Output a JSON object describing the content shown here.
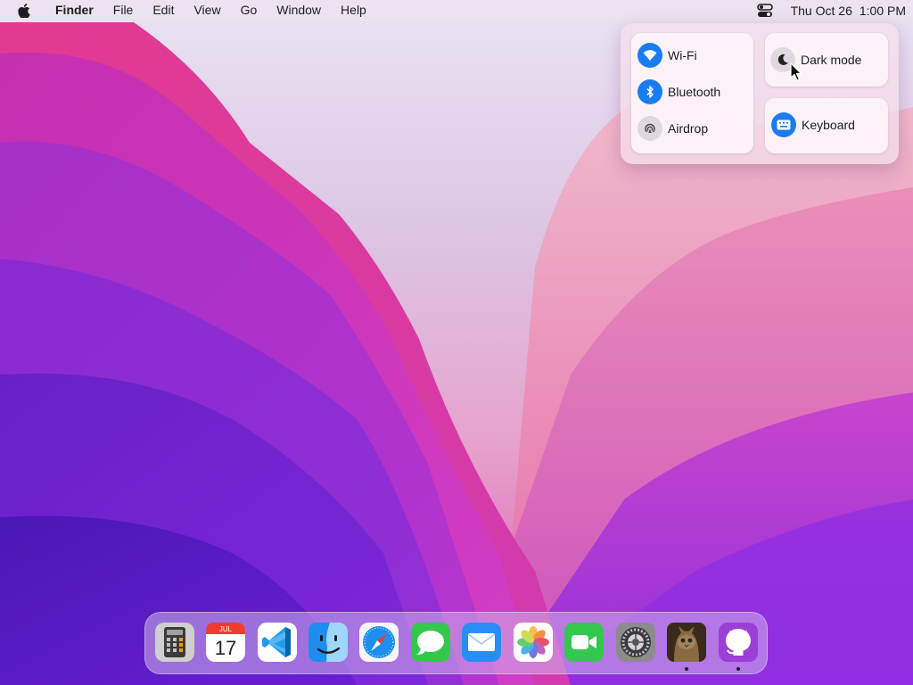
{
  "menubar": {
    "apple_icon": "apple-logo-icon",
    "app_name": "Finder",
    "menus": [
      "File",
      "Edit",
      "View",
      "Go",
      "Window",
      "Help"
    ],
    "control_center_icon": "control-center-icon",
    "date": "Thu Oct 26",
    "time": "1:00 PM"
  },
  "control_center": {
    "wifi": {
      "label": "Wi-Fi",
      "icon": "wifi-icon",
      "state": "on"
    },
    "bluetooth": {
      "label": "Bluetooth",
      "icon": "bluetooth-icon",
      "state": "on"
    },
    "airdrop": {
      "label": "Airdrop",
      "icon": "airdrop-icon",
      "state": "off"
    },
    "dark_mode": {
      "label": "Dark mode",
      "icon": "moon-icon",
      "state": "off"
    },
    "keyboard": {
      "label": "Keyboard",
      "icon": "keyboard-icon",
      "state": "on"
    }
  },
  "dock": {
    "calendar_month": "JUL",
    "calendar_day": "17",
    "apps": [
      {
        "name": "Calculator",
        "icon": "calculator-icon",
        "running": false
      },
      {
        "name": "Calendar",
        "icon": "calendar-icon",
        "running": false
      },
      {
        "name": "Visual Studio Code",
        "icon": "vscode-icon",
        "running": false
      },
      {
        "name": "Finder",
        "icon": "finder-icon",
        "running": false
      },
      {
        "name": "Safari",
        "icon": "safari-icon",
        "running": false
      },
      {
        "name": "Messages",
        "icon": "messages-icon",
        "running": false
      },
      {
        "name": "Mail",
        "icon": "mail-icon",
        "running": false
      },
      {
        "name": "Photos",
        "icon": "photos-icon",
        "running": false
      },
      {
        "name": "FaceTime",
        "icon": "facetime-icon",
        "running": false
      },
      {
        "name": "System Preferences",
        "icon": "settings-icon",
        "running": false
      },
      {
        "name": "Cat Photo",
        "icon": "cat-icon",
        "running": true
      },
      {
        "name": "GitHub",
        "icon": "github-icon",
        "running": true
      }
    ]
  },
  "colors": {
    "accent_blue": "#1a7cf3",
    "wallpaper_pink": "#e03aa8",
    "wallpaper_purple": "#6a1fd6"
  }
}
